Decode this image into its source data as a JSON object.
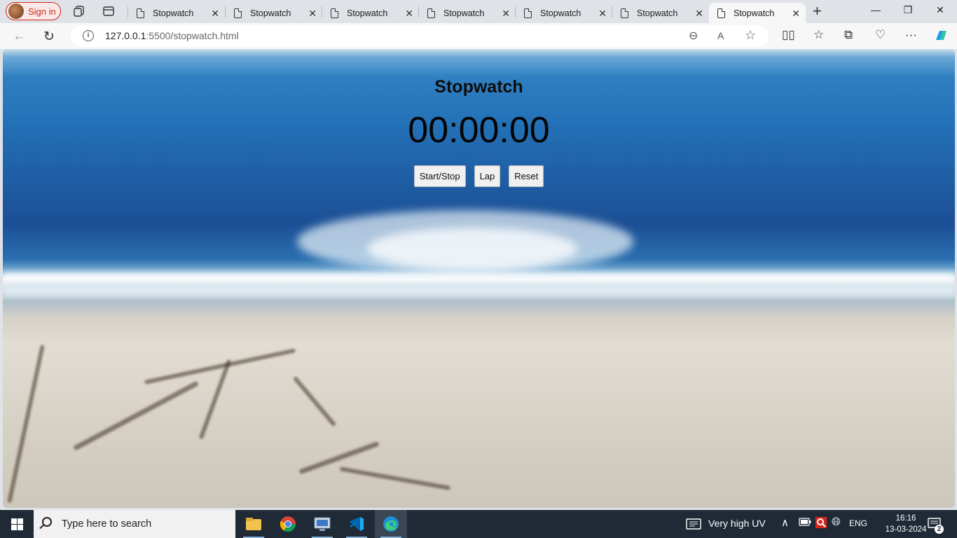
{
  "browser": {
    "profile_label": "Sign in",
    "tabs": [
      {
        "title": "Stopwatch"
      },
      {
        "title": "Stopwatch"
      },
      {
        "title": "Stopwatch"
      },
      {
        "title": "Stopwatch"
      },
      {
        "title": "Stopwatch"
      },
      {
        "title": "Stopwatch"
      },
      {
        "title": "Stopwatch"
      }
    ],
    "url_host": "127.0.0.1",
    "url_path": ":5500/stopwatch.html"
  },
  "page": {
    "title": "Stopwatch",
    "display": "00:00:00",
    "buttons": {
      "start_stop": "Start/Stop",
      "lap": "Lap",
      "reset": "Reset"
    }
  },
  "taskbar": {
    "search_placeholder": "Type here to search",
    "weather": "Very high UV",
    "language": "ENG",
    "time": "16:16",
    "date": "13-03-2024",
    "notifications": "2"
  },
  "colors": {
    "profile_accent": "#c42b1c",
    "taskbar_bg": "#1f2a36",
    "sea_blue": "#2370b6",
    "sand": "#e2ddd3"
  }
}
